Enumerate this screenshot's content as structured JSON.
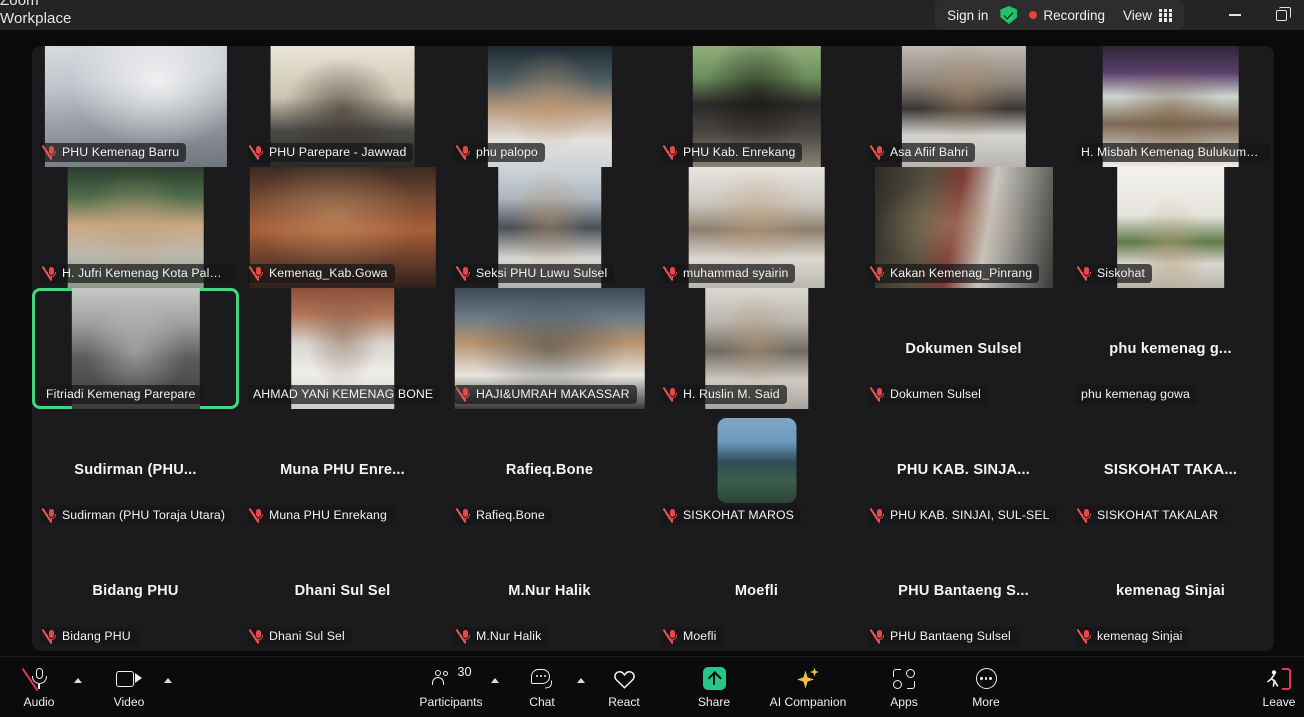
{
  "window": {
    "app_title": "Zoom\nWorkplace",
    "sign_in_label": "Sign in",
    "security_icon": "shield-check-icon",
    "recording_label": "Recording",
    "view_label": "View",
    "view_icon": "grid-icon",
    "minimize_label": "Minimize",
    "maximize_label": "Restore",
    "accent_green": "#23c268",
    "recording_red": "#e8413c"
  },
  "gallery": {
    "columns": 6,
    "rows": 5,
    "active_speaker": "Fitriadi Kemenag Parepare",
    "speaking_border_color": "#43d67f",
    "mute_icon_color": "#e8484a",
    "tiles": [
      {
        "name": "PHU Kemenag Barru",
        "kind": "video",
        "muted": true,
        "speaking": false
      },
      {
        "name": "PHU Parepare - Jawwad",
        "kind": "video",
        "muted": true,
        "speaking": false
      },
      {
        "name": "phu palopo",
        "kind": "video",
        "muted": true,
        "speaking": false
      },
      {
        "name": "PHU Kab. Enrekang",
        "kind": "video",
        "muted": true,
        "speaking": false
      },
      {
        "name": "Asa Afiif Bahri",
        "kind": "video",
        "muted": true,
        "speaking": false
      },
      {
        "name": "H. Misbah Kemenag Bulukumba.",
        "kind": "video",
        "muted": false,
        "speaking": false
      },
      {
        "name": "H. Jufri Kemenag Kota Palopo",
        "kind": "video",
        "muted": true,
        "speaking": false
      },
      {
        "name": "Kemenag_Kab.Gowa",
        "kind": "video",
        "muted": true,
        "speaking": false
      },
      {
        "name": "Seksi PHU Luwu Sulsel",
        "kind": "video",
        "muted": true,
        "speaking": false
      },
      {
        "name": "muhammad syairin",
        "kind": "video",
        "muted": true,
        "speaking": false
      },
      {
        "name": "Kakan Kemenag_Pinrang",
        "kind": "video",
        "muted": true,
        "speaking": false
      },
      {
        "name": "Siskohat",
        "kind": "video",
        "muted": true,
        "speaking": false
      },
      {
        "name": "Fitriadi Kemenag Parepare",
        "kind": "video",
        "muted": false,
        "speaking": true
      },
      {
        "name": "AHMAD YANi KEMENAG BONE",
        "kind": "video",
        "muted": false,
        "speaking": false
      },
      {
        "name": "HAJI&UMRAH MAKASSAR",
        "kind": "video",
        "muted": true,
        "speaking": false
      },
      {
        "name": "H. Ruslin M. Said",
        "kind": "video",
        "muted": true,
        "speaking": false
      },
      {
        "name": "Dokumen Sulsel",
        "display_name": "Dokumen Sulsel",
        "kind": "name",
        "muted": true,
        "speaking": false
      },
      {
        "name": "phu kemenag gowa",
        "display_name": "phu  kemenag  g...",
        "kind": "name",
        "muted": false,
        "speaking": false
      },
      {
        "name": "Sudirman (PHU Toraja Utara)",
        "display_name": "Sudirman  (PHU...",
        "kind": "name",
        "muted": true,
        "speaking": false
      },
      {
        "name": "Muna PHU Enrekang",
        "display_name": "Muna  PHU  Enre...",
        "kind": "name",
        "muted": true,
        "speaking": false
      },
      {
        "name": "Rafieq.Bone",
        "display_name": "Rafieq.Bone",
        "kind": "name",
        "muted": true,
        "speaking": false
      },
      {
        "name": "SISKOHAT MAROS",
        "kind": "avatar",
        "muted": true,
        "speaking": false
      },
      {
        "name": "PHU KAB. SINJAI, SUL-SEL",
        "display_name": "PHU KAB. SINJA...",
        "kind": "name",
        "muted": true,
        "speaking": false
      },
      {
        "name": "SISKOHAT TAKALAR",
        "display_name": "SISKOHAT  TAKA...",
        "kind": "name",
        "muted": true,
        "speaking": false
      },
      {
        "name": "Bidang PHU",
        "display_name": "Bidang PHU",
        "kind": "name",
        "muted": true,
        "speaking": false
      },
      {
        "name": "Dhani Sul Sel",
        "display_name": "Dhani Sul Sel",
        "kind": "name",
        "muted": true,
        "speaking": false
      },
      {
        "name": "M.Nur Halik",
        "display_name": "M.Nur Halik",
        "kind": "name",
        "muted": true,
        "speaking": false
      },
      {
        "name": "Moefli",
        "display_name": "Moefli",
        "kind": "name",
        "muted": true,
        "speaking": false
      },
      {
        "name": "PHU Bantaeng Sulsel",
        "display_name": "PHU  Bantaeng  S...",
        "kind": "name",
        "muted": true,
        "speaking": false
      },
      {
        "name": "kemenag Sinjai",
        "display_name": "kemenag Sinjai",
        "kind": "name",
        "muted": true,
        "speaking": false
      }
    ]
  },
  "toolbar": {
    "audio": {
      "label": "Audio",
      "icon": "microphone-muted-icon",
      "muted": true,
      "has_caret": true
    },
    "video": {
      "label": "Video",
      "icon": "camera-icon",
      "has_caret": true
    },
    "participants": {
      "label": "Participants",
      "icon": "people-icon",
      "count": "30",
      "has_caret": true
    },
    "chat": {
      "label": "Chat",
      "icon": "chat-bubble-icon",
      "has_caret": true
    },
    "react": {
      "label": "React",
      "icon": "heart-icon"
    },
    "share": {
      "label": "Share",
      "icon": "share-screen-icon",
      "color": "#22c989"
    },
    "ai_companion": {
      "label": "AI Companion",
      "icon": "sparkle-icon",
      "color": "#f3c23c"
    },
    "apps": {
      "label": "Apps",
      "icon": "apps-icon"
    },
    "more": {
      "label": "More",
      "icon": "ellipsis-icon"
    },
    "leave": {
      "label": "Leave",
      "icon": "leave-door-icon",
      "color": "#e8325a"
    }
  }
}
